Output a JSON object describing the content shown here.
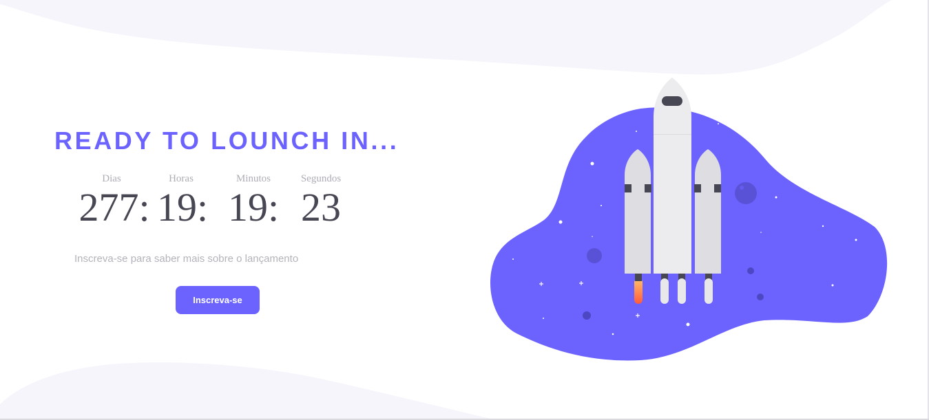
{
  "hero": {
    "title": "READY TO LOUNCH IN...",
    "subtitle": "Inscreva-se para saber mais sobre o lançamento",
    "cta_label": "Inscreva-se"
  },
  "countdown": {
    "days": {
      "label": "Dias",
      "value": "277:"
    },
    "hours": {
      "label": "Horas",
      "value": "19:"
    },
    "minutes": {
      "label": "Minutos",
      "value": "19:"
    },
    "seconds": {
      "label": "Segundos",
      "value": "23"
    }
  },
  "theme": {
    "accent": "#6c63ff",
    "text_dark": "#474753",
    "text_muted": "#adadb6",
    "wave": "#f5f5fb"
  }
}
